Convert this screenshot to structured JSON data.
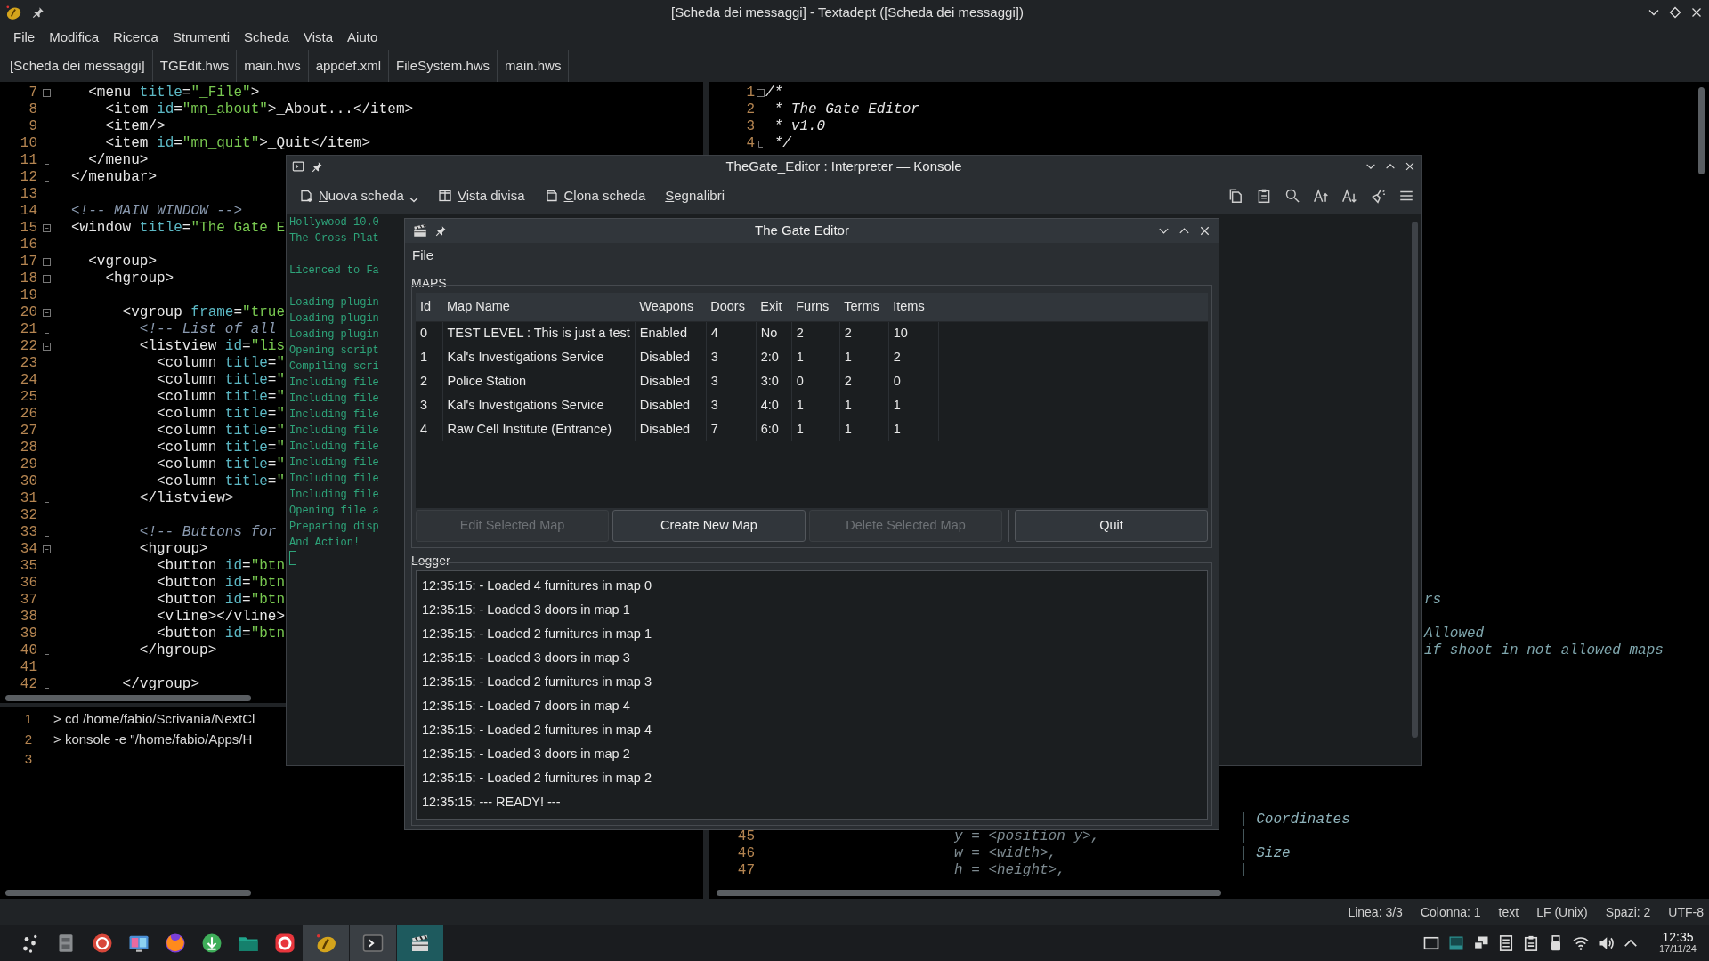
{
  "window": {
    "title": "[Scheda dei messaggi] - Textadept ([Scheda dei messaggi])"
  },
  "menu": [
    "File",
    "Modifica",
    "Ricerca",
    "Strumenti",
    "Scheda",
    "Vista",
    "Aiuto"
  ],
  "tabs": [
    "[Scheda dei messaggi]",
    "TGEdit.hws",
    "main.hws",
    "appdef.xml",
    "FileSystem.hws",
    "main.hws"
  ],
  "left_editor": {
    "lines": [
      {
        "number": "7",
        "kind": "fold_start",
        "tokens": [
          {
            "kind": "tag",
            "text": "  <menu"
          },
          {
            "kind": "attr",
            "text": " title"
          },
          {
            "kind": "tag",
            "text": "="
          },
          {
            "kind": "str",
            "text": "\"_File\""
          },
          {
            "kind": "tag",
            "text": ">"
          }
        ]
      },
      {
        "number": "8",
        "kind": "plain",
        "tokens": [
          {
            "kind": "tag",
            "text": "    <item"
          },
          {
            "kind": "attr",
            "text": " id"
          },
          {
            "kind": "tag",
            "text": "="
          },
          {
            "kind": "str",
            "text": "\"mn_about\""
          },
          {
            "kind": "tag",
            "text": ">_About...</item>"
          }
        ]
      },
      {
        "number": "9",
        "kind": "plain",
        "tokens": [
          {
            "kind": "tag",
            "text": "    <item/>"
          }
        ]
      },
      {
        "number": "10",
        "kind": "plain",
        "tokens": [
          {
            "kind": "tag",
            "text": "    <item"
          },
          {
            "kind": "attr",
            "text": " id"
          },
          {
            "kind": "tag",
            "text": "="
          },
          {
            "kind": "str",
            "text": "\"mn_quit\""
          },
          {
            "kind": "tag",
            "text": ">_Quit</item>"
          }
        ]
      },
      {
        "number": "11",
        "kind": "fold_end",
        "tokens": [
          {
            "kind": "tag",
            "text": "  </menu>"
          }
        ]
      },
      {
        "number": "12",
        "kind": "fold_end",
        "tokens": [
          {
            "kind": "tag",
            "text": "</menubar>"
          }
        ]
      },
      {
        "number": "13",
        "kind": "plain"
      },
      {
        "number": "14",
        "kind": "plain",
        "tokens": [
          {
            "kind": "comment",
            "text": "<!-- MAIN WINDOW -->"
          }
        ]
      },
      {
        "number": "15",
        "kind": "fold_start",
        "tokens": [
          {
            "kind": "tag",
            "text": "<window"
          },
          {
            "kind": "attr",
            "text": " title"
          },
          {
            "kind": "tag",
            "text": "="
          },
          {
            "kind": "str",
            "text": "\"The Gate E"
          }
        ]
      },
      {
        "number": "16",
        "kind": "plain"
      },
      {
        "number": "17",
        "kind": "fold_start",
        "tokens": [
          {
            "kind": "tag",
            "text": "  <vgroup>"
          }
        ]
      },
      {
        "number": "18",
        "kind": "fold_start",
        "tokens": [
          {
            "kind": "tag",
            "text": "    <hgroup>"
          }
        ]
      },
      {
        "number": "19",
        "kind": "plain"
      },
      {
        "number": "20",
        "kind": "fold_start",
        "tokens": [
          {
            "kind": "tag",
            "text": "      <vgroup"
          },
          {
            "kind": "attr",
            "text": " frame"
          },
          {
            "kind": "tag",
            "text": "="
          },
          {
            "kind": "str",
            "text": "\"true"
          }
        ]
      },
      {
        "number": "21",
        "kind": "fold_end",
        "tokens": [
          {
            "kind": "comment",
            "text": "        <!-- List of all"
          }
        ]
      },
      {
        "number": "22",
        "kind": "fold_start",
        "tokens": [
          {
            "kind": "tag",
            "text": "        <listview"
          },
          {
            "kind": "attr",
            "text": " id"
          },
          {
            "kind": "tag",
            "text": "="
          },
          {
            "kind": "str",
            "text": "\"lis"
          }
        ]
      },
      {
        "number": "23",
        "kind": "plain",
        "tokens": [
          {
            "kind": "tag",
            "text": "          <column"
          },
          {
            "kind": "attr",
            "text": " title"
          },
          {
            "kind": "tag",
            "text": "="
          },
          {
            "kind": "str",
            "text": "\""
          }
        ]
      },
      {
        "number": "24",
        "kind": "plain",
        "tokens": [
          {
            "kind": "tag",
            "text": "          <column"
          },
          {
            "kind": "attr",
            "text": " title"
          },
          {
            "kind": "tag",
            "text": "="
          },
          {
            "kind": "str",
            "text": "\""
          }
        ]
      },
      {
        "number": "25",
        "kind": "plain",
        "tokens": [
          {
            "kind": "tag",
            "text": "          <column"
          },
          {
            "kind": "attr",
            "text": " title"
          },
          {
            "kind": "tag",
            "text": "="
          },
          {
            "kind": "str",
            "text": "\""
          }
        ]
      },
      {
        "number": "26",
        "kind": "plain",
        "tokens": [
          {
            "kind": "tag",
            "text": "          <column"
          },
          {
            "kind": "attr",
            "text": " title"
          },
          {
            "kind": "tag",
            "text": "="
          },
          {
            "kind": "str",
            "text": "\""
          }
        ]
      },
      {
        "number": "27",
        "kind": "plain",
        "tokens": [
          {
            "kind": "tag",
            "text": "          <column"
          },
          {
            "kind": "attr",
            "text": " title"
          },
          {
            "kind": "tag",
            "text": "="
          },
          {
            "kind": "str",
            "text": "\""
          }
        ]
      },
      {
        "number": "28",
        "kind": "plain",
        "tokens": [
          {
            "kind": "tag",
            "text": "          <column"
          },
          {
            "kind": "attr",
            "text": " title"
          },
          {
            "kind": "tag",
            "text": "="
          },
          {
            "kind": "str",
            "text": "\""
          }
        ]
      },
      {
        "number": "29",
        "kind": "plain",
        "tokens": [
          {
            "kind": "tag",
            "text": "          <column"
          },
          {
            "kind": "attr",
            "text": " title"
          },
          {
            "kind": "tag",
            "text": "="
          },
          {
            "kind": "str",
            "text": "\""
          }
        ]
      },
      {
        "number": "30",
        "kind": "plain",
        "tokens": [
          {
            "kind": "tag",
            "text": "          <column"
          },
          {
            "kind": "attr",
            "text": " title"
          },
          {
            "kind": "tag",
            "text": "="
          },
          {
            "kind": "str",
            "text": "\""
          }
        ]
      },
      {
        "number": "31",
        "kind": "fold_end",
        "tokens": [
          {
            "kind": "tag",
            "text": "        </listview>"
          }
        ]
      },
      {
        "number": "32",
        "kind": "plain"
      },
      {
        "number": "33",
        "kind": "fold_end",
        "tokens": [
          {
            "kind": "comment",
            "text": "        <!-- Buttons for"
          }
        ]
      },
      {
        "number": "34",
        "kind": "fold_start",
        "tokens": [
          {
            "kind": "tag",
            "text": "        <hgroup>"
          }
        ]
      },
      {
        "number": "35",
        "kind": "plain",
        "tokens": [
          {
            "kind": "tag",
            "text": "          <button"
          },
          {
            "kind": "attr",
            "text": " id"
          },
          {
            "kind": "tag",
            "text": "="
          },
          {
            "kind": "str",
            "text": "\"btn"
          }
        ]
      },
      {
        "number": "36",
        "kind": "plain",
        "tokens": [
          {
            "kind": "tag",
            "text": "          <button"
          },
          {
            "kind": "attr",
            "text": " id"
          },
          {
            "kind": "tag",
            "text": "="
          },
          {
            "kind": "str",
            "text": "\"btn"
          }
        ]
      },
      {
        "number": "37",
        "kind": "plain",
        "tokens": [
          {
            "kind": "tag",
            "text": "          <button"
          },
          {
            "kind": "attr",
            "text": " id"
          },
          {
            "kind": "tag",
            "text": "="
          },
          {
            "kind": "str",
            "text": "\"btn"
          }
        ]
      },
      {
        "number": "38",
        "kind": "plain",
        "tokens": [
          {
            "kind": "tag",
            "text": "          <vline></vline>"
          }
        ]
      },
      {
        "number": "39",
        "kind": "plain",
        "tokens": [
          {
            "kind": "tag",
            "text": "          <button"
          },
          {
            "kind": "attr",
            "text": " id"
          },
          {
            "kind": "tag",
            "text": "="
          },
          {
            "kind": "str",
            "text": "\"btn"
          }
        ]
      },
      {
        "number": "40",
        "kind": "fold_end",
        "tokens": [
          {
            "kind": "tag",
            "text": "        </hgroup>"
          }
        ]
      },
      {
        "number": "41",
        "kind": "plain"
      },
      {
        "number": "42",
        "kind": "fold_end",
        "tokens": [
          {
            "kind": "tag",
            "text": "      </vgroup>"
          }
        ]
      }
    ]
  },
  "output_pane": {
    "lines": [
      {
        "number": "1",
        "text": "> cd /home/fabio/Scrivania/NextCl"
      },
      {
        "number": "2",
        "text": "> konsole -e \"/home/fabio/Apps/H"
      },
      {
        "number": "3"
      }
    ]
  },
  "right_editor": {
    "top_lines": [
      {
        "number": "1",
        "kind": "fold_start",
        "code": "/*"
      },
      {
        "number": "2",
        "kind": "plain",
        "code": " * The Gate Editor"
      },
      {
        "number": "3",
        "kind": "plain",
        "code": " * v1.0"
      },
      {
        "number": "4",
        "kind": "fold_end",
        "code": " */"
      }
    ],
    "side_fragments": [
      "rs",
      "Allowed",
      "if shoot in not allowed maps"
    ],
    "bottom_lines": [
      {
        "note": "| Coordinates"
      },
      {
        "number": "45",
        "code": "y = <position y>,",
        "note": "|"
      },
      {
        "number": "46",
        "code": "w = <width>,",
        "note": "| Size"
      },
      {
        "number": "47",
        "code": "h = <height>,",
        "note": "|"
      }
    ]
  },
  "status_bar": [
    "Linea: 3/3",
    "Colonna: 1",
    "text",
    "LF (Unix)",
    "Spazi: 2",
    "UTF-8"
  ],
  "konsole": {
    "title": "TheGate_Editor : Interpreter — Konsole",
    "toolbar": [
      {
        "kind": "new",
        "label": "Nuova scheda",
        "dropdown": true
      },
      {
        "kind": "split",
        "label": "Vista divisa"
      },
      {
        "kind": "clone",
        "label": "Clona scheda"
      },
      {
        "kind": "plain",
        "label": "Segnalibri"
      }
    ],
    "terminal_blocks": [
      [
        "Hollywood 10.0",
        "The Cross-Plat"
      ],
      [
        "Licenced to Fa"
      ],
      [
        "Loading plugin",
        "Loading plugin",
        "Loading plugin",
        "Opening script",
        "Compiling scri",
        "Including file",
        "Including file",
        "Including file",
        "Including file",
        "Including file",
        "Including file",
        "Including file",
        "Including file",
        "Opening file a",
        "Preparing disp",
        "And Action!"
      ]
    ]
  },
  "gate_editor": {
    "title": "The Gate Editor",
    "menu": [
      "File"
    ],
    "maps_label": "MAPS",
    "table": {
      "columns": [
        "Id",
        "Map Name",
        "Weapons",
        "Doors",
        "Exit",
        "Furns",
        "Terms",
        "Items"
      ],
      "rows": [
        [
          "0",
          "TEST LEVEL : This is just a test",
          "Enabled",
          "4",
          "No",
          "2",
          "2",
          "10"
        ],
        [
          "1",
          "Kal's Investigations Service",
          "Disabled",
          "3",
          "2:0",
          "1",
          "1",
          "2"
        ],
        [
          "2",
          "Police Station",
          "Disabled",
          "3",
          "3:0",
          "0",
          "2",
          "0"
        ],
        [
          "3",
          "Kal's Investigations Service",
          "Disabled",
          "3",
          "4:0",
          "1",
          "1",
          "1"
        ],
        [
          "4",
          "Raw Cell Institute (Entrance)",
          "Disabled",
          "7",
          "6:0",
          "1",
          "1",
          "1"
        ]
      ]
    },
    "buttons": [
      {
        "label": "Edit Selected Map",
        "disabled": true
      },
      {
        "label": "Create New Map",
        "disabled": false
      },
      {
        "label": "Delete Selected Map",
        "disabled": true
      },
      {
        "label": "Quit",
        "disabled": false
      }
    ],
    "logger_label": "Logger",
    "log": [
      "12:35:15: - Loaded 4 furnitures in map 0",
      "12:35:15: - Loaded 3 doors in map 1",
      "12:35:15: - Loaded 2 furnitures in map 1",
      "12:35:15: - Loaded 3 doors in map 3",
      "12:35:15: - Loaded 2 furnitures in map 3",
      "12:35:15: - Loaded 7 doors in map 4",
      "12:35:15: - Loaded 2 furnitures in map 4",
      "12:35:15: - Loaded 3 doors in map 2",
      "12:35:15: - Loaded 2 furnitures in map 2",
      "12:35:15: --- READY! ---"
    ]
  },
  "taskbar": {
    "items": [
      {
        "kind": "launcher",
        "running": false,
        "selected": false
      },
      {
        "kind": "cabinet",
        "running": false,
        "selected": false
      },
      {
        "kind": "redapp",
        "running": false,
        "selected": false
      },
      {
        "kind": "monitor",
        "running": false,
        "selected": false
      },
      {
        "kind": "browser",
        "running": false,
        "selected": false
      },
      {
        "kind": "download",
        "running": false,
        "selected": false
      },
      {
        "kind": "folder",
        "running": false,
        "selected": false
      },
      {
        "kind": "vivaldi",
        "running": false,
        "selected": false
      },
      {
        "kind": "editor",
        "running": true,
        "selected": false
      },
      {
        "kind": "terminal",
        "running": true,
        "selected": false
      },
      {
        "kind": "clapper",
        "running": true,
        "selected": true
      }
    ],
    "tray": [
      {
        "kind": "desktop"
      },
      {
        "kind": "screen"
      },
      {
        "kind": "display"
      },
      {
        "kind": "notes"
      },
      {
        "kind": "clipboard"
      },
      {
        "kind": "usb"
      },
      {
        "kind": "wifi"
      },
      {
        "kind": "volume"
      },
      {
        "kind": "expand"
      }
    ],
    "clock": "12:35",
    "date": "17/11/24"
  }
}
